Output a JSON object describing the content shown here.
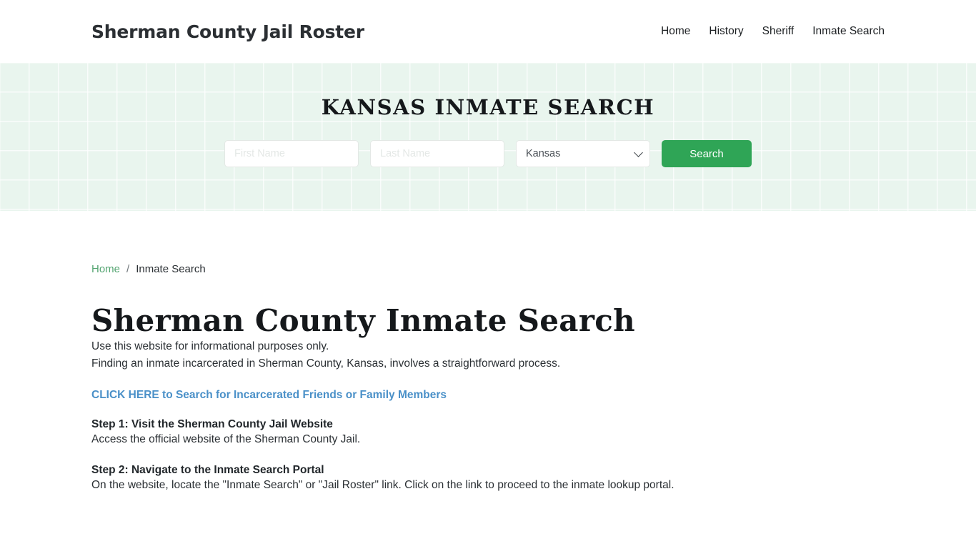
{
  "header": {
    "brand": "Sherman County Jail Roster",
    "nav": [
      {
        "label": "Home"
      },
      {
        "label": "History"
      },
      {
        "label": "Sheriff"
      },
      {
        "label": "Inmate Search"
      }
    ]
  },
  "hero": {
    "title": "Kansas Inmate Search",
    "form": {
      "first_name_placeholder": "First Name",
      "first_name_value": "",
      "last_name_placeholder": "Last Name",
      "last_name_value": "",
      "state_selected": "Kansas",
      "state_options": [
        "Kansas"
      ],
      "submit_label": "Search"
    },
    "background_color": "#e9f5ee",
    "accent_color": "#2fa556"
  },
  "breadcrumb": {
    "home_label": "Home",
    "separator": "/",
    "current_label": "Inmate Search"
  },
  "main": {
    "page_title": "Sherman County Inmate Search",
    "paragraph_1": "Use this website for informational purposes only.",
    "paragraph_2": "Finding an inmate incarcerated in Sherman County, Kansas, involves a straightforward process.",
    "cta_link": "CLICK HERE to Search for Incarcerated Friends or Family Members",
    "cta_color": "#4a90c8",
    "step_1_heading": "Step 1: Visit the Sherman County Jail Website",
    "step_1_text": "Access the official website of the Sherman County Jail.",
    "step_2_heading": "Step 2: Navigate to the Inmate Search Portal",
    "step_2_text": "On the website, locate the \"Inmate Search\" or \"Jail Roster\" link. Click on the link to proceed to the inmate lookup portal."
  }
}
